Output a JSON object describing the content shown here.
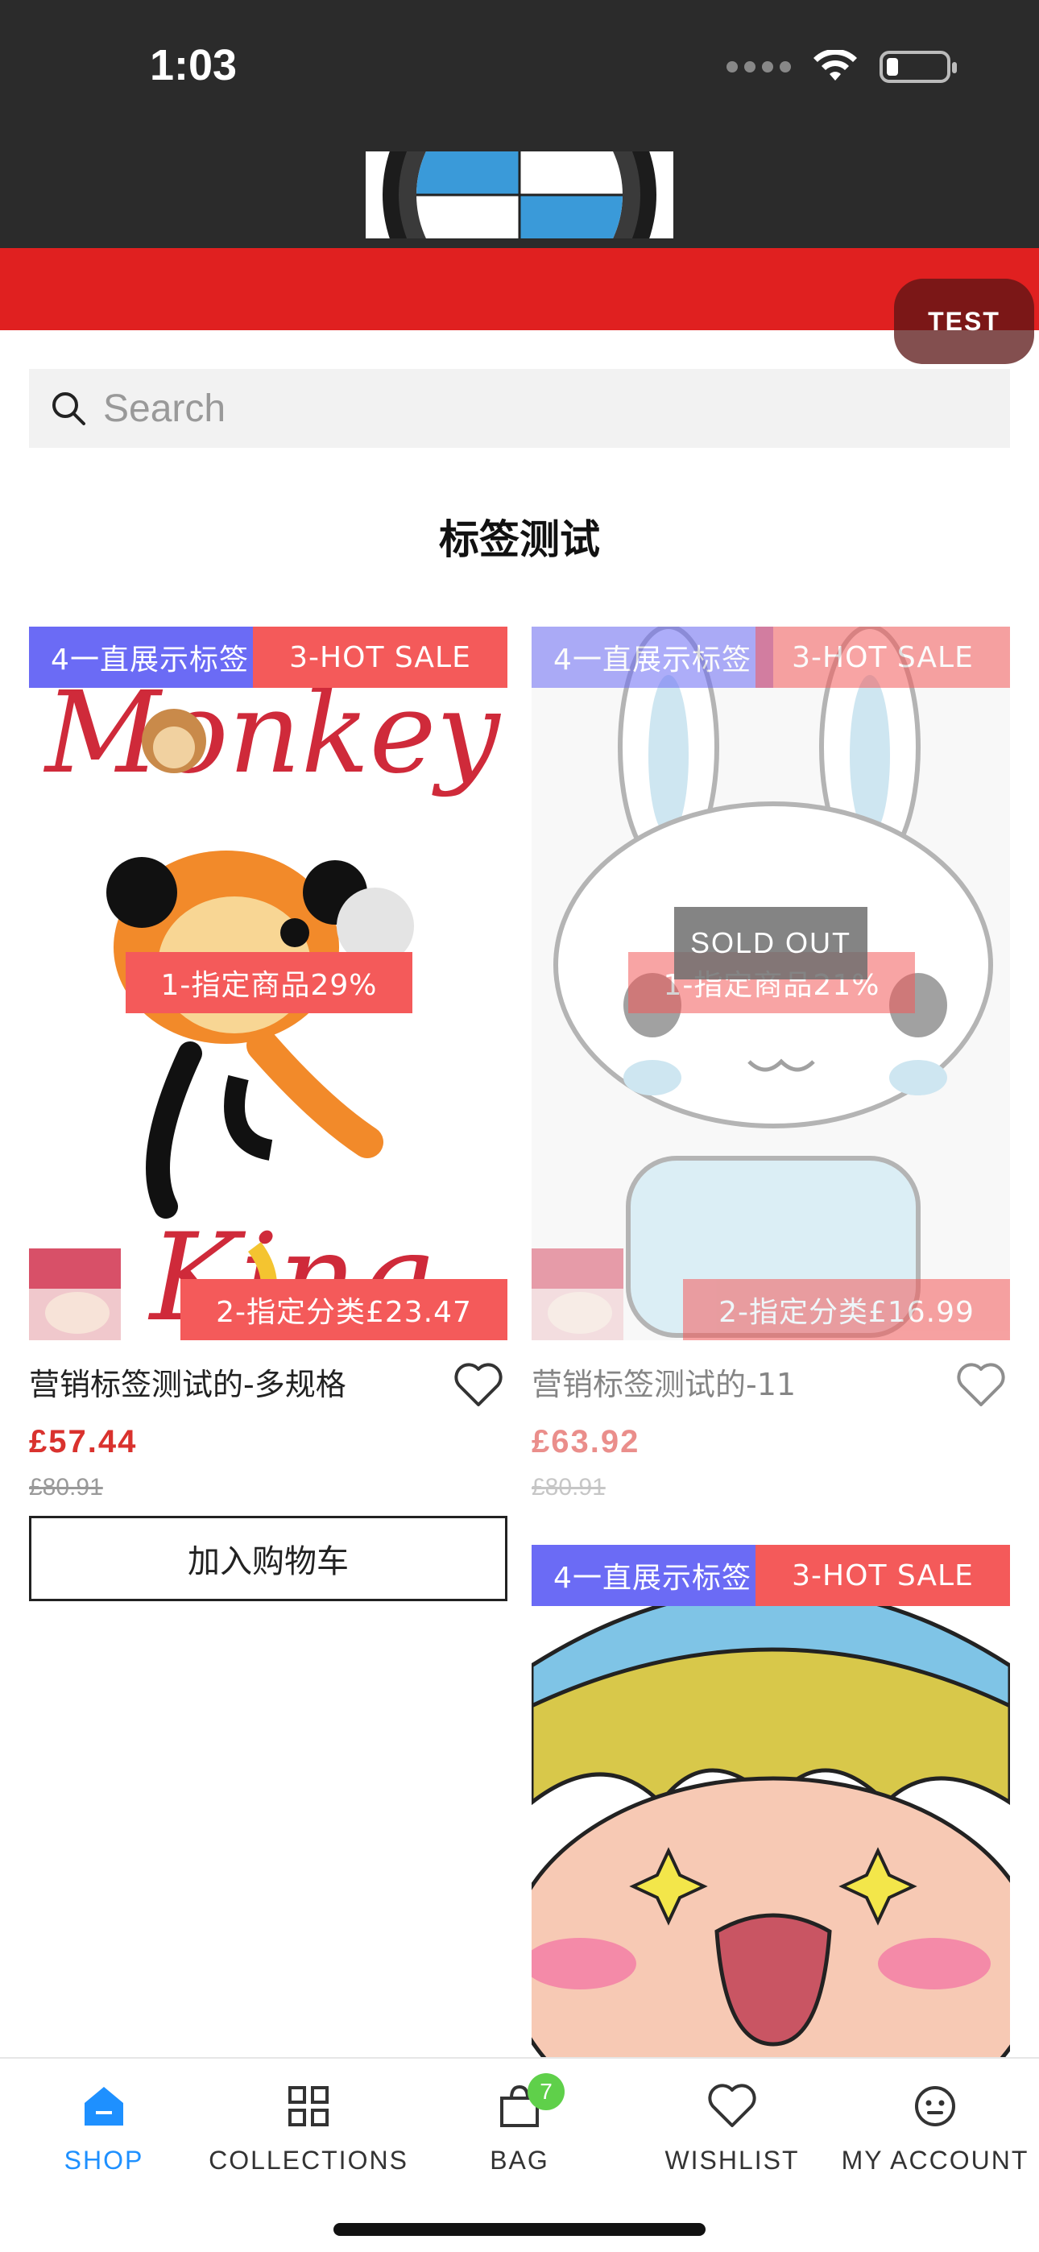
{
  "status_bar": {
    "time": "1:03"
  },
  "header": {
    "test_label": "TEST"
  },
  "search": {
    "placeholder": "Search"
  },
  "page_title": "标签测试",
  "products": [
    {
      "tag_left": "4一直展示标签",
      "tag_right": "3-HOT SALE",
      "tag_center": "1-指定商品29%",
      "tag_bottom": "2-指定分类£23.47",
      "title": "营销标签测试的-多规格",
      "price": "£57.44",
      "old_price": "£80.91",
      "add_to_cart": "加入购物车",
      "image_text_top": "Monkey",
      "image_text_bottom": "King"
    },
    {
      "tag_left": "4一直展示标签",
      "tag_right": "3-HOT SALE",
      "tag_center": "1-指定商品21%",
      "tag_bottom": "2-指定分类£16.99",
      "title": "营销标签测试的-11",
      "price": "£63.92",
      "old_price": "£80.91",
      "sold_out": "SOLD OUT"
    },
    {
      "tag_left": "4一直展示标签",
      "tag_right": "3-HOT SALE"
    }
  ],
  "bottom_nav": {
    "items": [
      {
        "label": "SHOP",
        "icon": "home-icon"
      },
      {
        "label": "COLLECTIONS",
        "icon": "grid-icon"
      },
      {
        "label": "BAG",
        "icon": "bag-icon",
        "badge": "7"
      },
      {
        "label": "WISHLIST",
        "icon": "heart-icon"
      },
      {
        "label": "MY ACCOUNT",
        "icon": "account-icon"
      }
    ]
  },
  "colors": {
    "accent": "#1e90ff",
    "price": "#d9322e",
    "banner": "#e02020",
    "tag_blue": "#6b6bf5",
    "tag_red": "#f45a5a"
  }
}
